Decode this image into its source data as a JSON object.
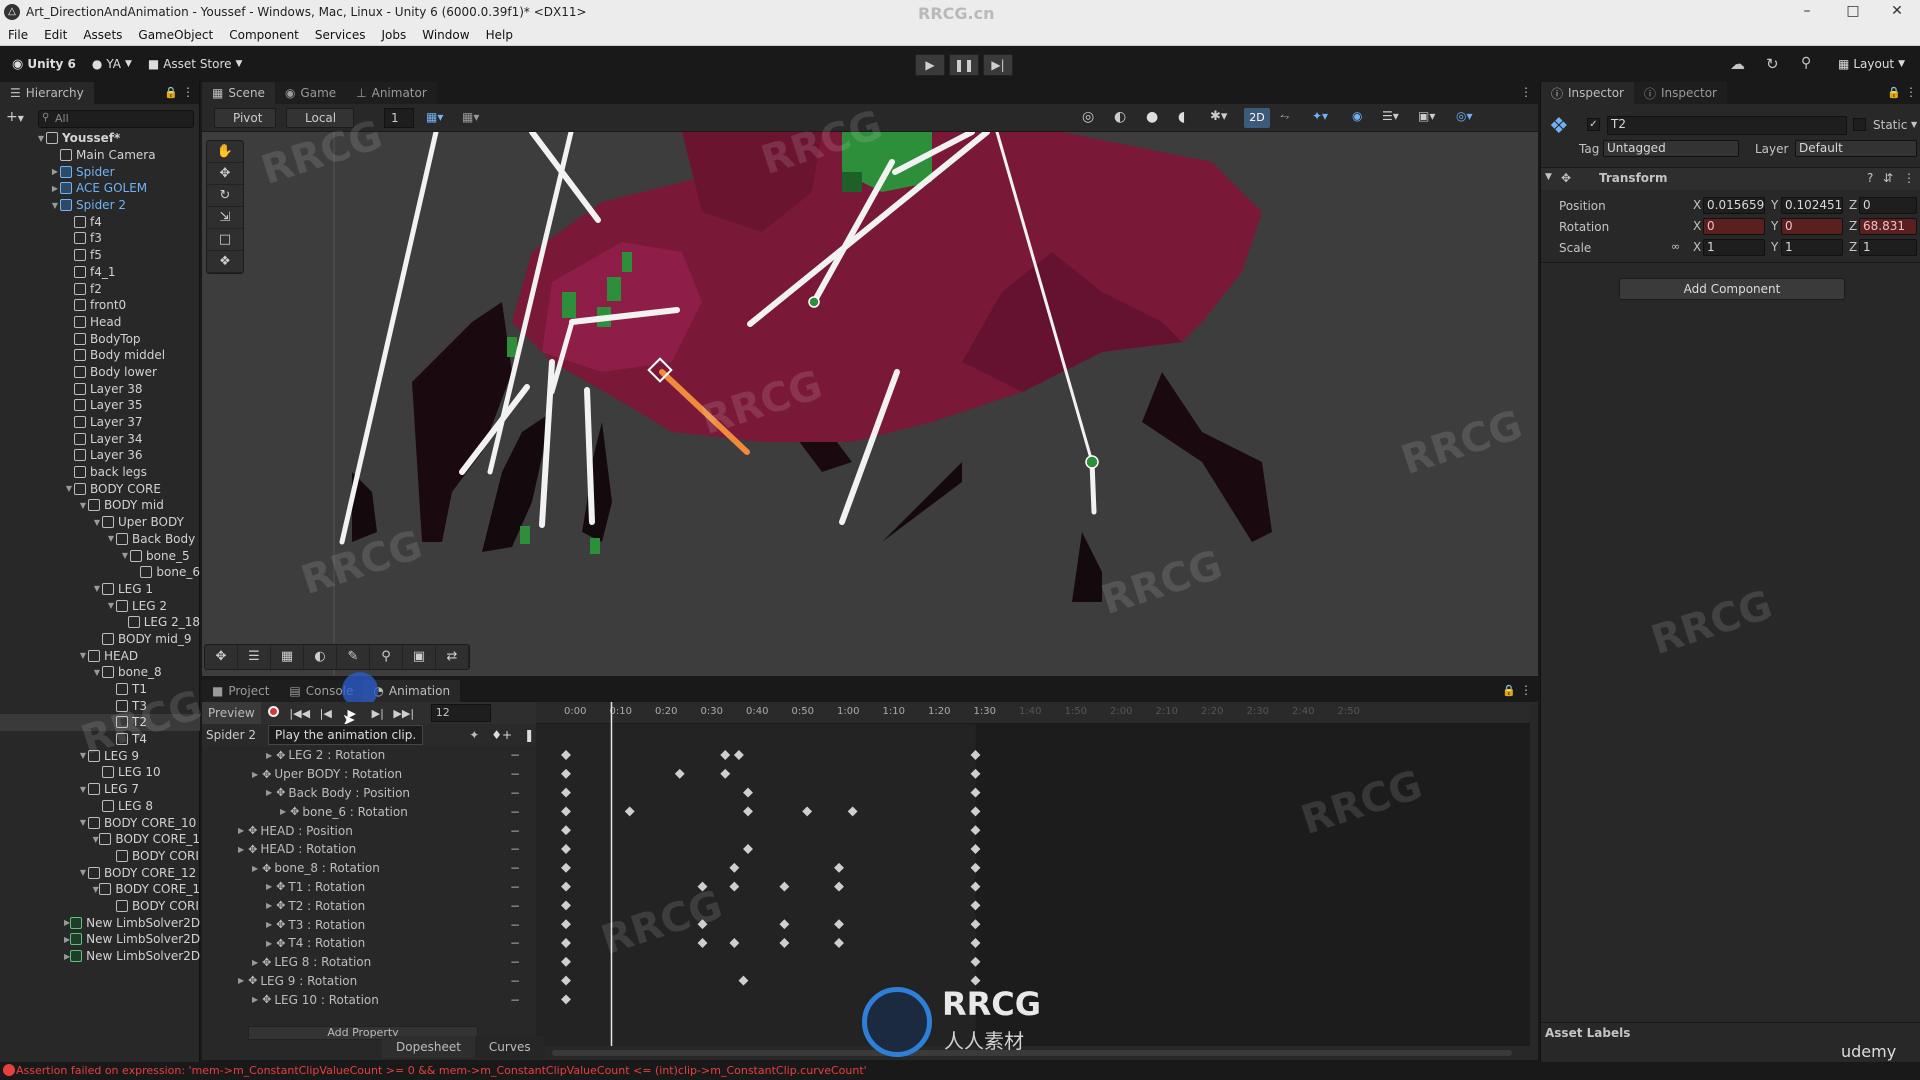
{
  "window": {
    "title": "Art_DirectionAndAnimation - Youssef - Windows, Mac, Linux - Unity 6 (6000.0.39f1)* <DX11>",
    "watermark_top": "RRCG.cn",
    "controls": [
      "–",
      "□",
      "✕"
    ]
  },
  "menu": [
    "File",
    "Edit",
    "Assets",
    "GameObject",
    "Component",
    "Services",
    "Jobs",
    "Window",
    "Help"
  ],
  "toolbar": {
    "unity_label": "Unity 6",
    "account_label": "YA",
    "asset_store_label": "Asset Store",
    "layout_label": "Layout"
  },
  "hierarchy": {
    "tab_label": "Hierarchy",
    "search_placeholder": "All",
    "items": [
      {
        "label": "Youssef*",
        "depth": 0,
        "arrow": "down",
        "type": "root"
      },
      {
        "label": "Main Camera",
        "depth": 1,
        "arrow": "",
        "type": "obj"
      },
      {
        "label": "Spider",
        "depth": 1,
        "arrow": "right",
        "type": "blue"
      },
      {
        "label": "ACE GOLEM",
        "depth": 1,
        "arrow": "right",
        "type": "blue"
      },
      {
        "label": "Spider 2",
        "depth": 1,
        "arrow": "down",
        "type": "blue"
      },
      {
        "label": "f4",
        "depth": 2,
        "arrow": "",
        "type": "obj"
      },
      {
        "label": "f3",
        "depth": 2,
        "arrow": "",
        "type": "obj"
      },
      {
        "label": "f5",
        "depth": 2,
        "arrow": "",
        "type": "obj"
      },
      {
        "label": "f4_1",
        "depth": 2,
        "arrow": "",
        "type": "obj"
      },
      {
        "label": "f2",
        "depth": 2,
        "arrow": "",
        "type": "obj"
      },
      {
        "label": "front0",
        "depth": 2,
        "arrow": "",
        "type": "obj"
      },
      {
        "label": "Head",
        "depth": 2,
        "arrow": "",
        "type": "obj"
      },
      {
        "label": "BodyTop",
        "depth": 2,
        "arrow": "",
        "type": "obj"
      },
      {
        "label": "Body middel",
        "depth": 2,
        "arrow": "",
        "type": "obj"
      },
      {
        "label": "Body lower",
        "depth": 2,
        "arrow": "",
        "type": "obj"
      },
      {
        "label": "Layer 38",
        "depth": 2,
        "arrow": "",
        "type": "obj"
      },
      {
        "label": "Layer 35",
        "depth": 2,
        "arrow": "",
        "type": "obj"
      },
      {
        "label": "Layer 37",
        "depth": 2,
        "arrow": "",
        "type": "obj"
      },
      {
        "label": "Layer 34",
        "depth": 2,
        "arrow": "",
        "type": "obj"
      },
      {
        "label": "Layer 36",
        "depth": 2,
        "arrow": "",
        "type": "obj"
      },
      {
        "label": "back legs",
        "depth": 2,
        "arrow": "",
        "type": "obj"
      },
      {
        "label": "BODY CORE",
        "depth": 2,
        "arrow": "down",
        "type": "obj"
      },
      {
        "label": "BODY mid",
        "depth": 3,
        "arrow": "down",
        "type": "obj"
      },
      {
        "label": "Uper BODY",
        "depth": 4,
        "arrow": "down",
        "type": "obj"
      },
      {
        "label": "Back Body",
        "depth": 5,
        "arrow": "down",
        "type": "obj"
      },
      {
        "label": "bone_5",
        "depth": 6,
        "arrow": "down",
        "type": "obj"
      },
      {
        "label": "bone_6",
        "depth": 7,
        "arrow": "",
        "type": "obj"
      },
      {
        "label": "LEG 1",
        "depth": 4,
        "arrow": "down",
        "type": "obj"
      },
      {
        "label": "LEG 2",
        "depth": 5,
        "arrow": "down",
        "type": "obj"
      },
      {
        "label": "LEG 2_18",
        "depth": 6,
        "arrow": "",
        "type": "obj"
      },
      {
        "label": "BODY mid_9",
        "depth": 4,
        "arrow": "",
        "type": "obj"
      },
      {
        "label": "HEAD",
        "depth": 3,
        "arrow": "down",
        "type": "obj"
      },
      {
        "label": "bone_8",
        "depth": 4,
        "arrow": "down",
        "type": "obj"
      },
      {
        "label": "T1",
        "depth": 5,
        "arrow": "",
        "type": "obj"
      },
      {
        "label": "T3",
        "depth": 5,
        "arrow": "",
        "type": "obj"
      },
      {
        "label": "T2",
        "depth": 5,
        "arrow": "",
        "type": "selected"
      },
      {
        "label": "T4",
        "depth": 5,
        "arrow": "",
        "type": "obj"
      },
      {
        "label": "LEG 9",
        "depth": 3,
        "arrow": "down",
        "type": "obj"
      },
      {
        "label": "LEG 10",
        "depth": 4,
        "arrow": "",
        "type": "obj"
      },
      {
        "label": "LEG 7",
        "depth": 3,
        "arrow": "down",
        "type": "obj"
      },
      {
        "label": "LEG 8",
        "depth": 4,
        "arrow": "",
        "type": "obj"
      },
      {
        "label": "BODY CORE_10",
        "depth": 3,
        "arrow": "down",
        "type": "obj"
      },
      {
        "label": "BODY CORE_1",
        "depth": 4,
        "arrow": "down",
        "type": "obj"
      },
      {
        "label": "BODY CORI",
        "depth": 5,
        "arrow": "",
        "type": "obj"
      },
      {
        "label": "BODY CORE_12",
        "depth": 3,
        "arrow": "down",
        "type": "obj"
      },
      {
        "label": "BODY CORE_1",
        "depth": 4,
        "arrow": "down",
        "type": "obj"
      },
      {
        "label": "BODY CORI",
        "depth": 5,
        "arrow": "",
        "type": "obj"
      },
      {
        "label": "New LimbSolver2D",
        "depth": 2,
        "arrow": "right",
        "type": "green"
      },
      {
        "label": "New LimbSolver2D",
        "depth": 2,
        "arrow": "right",
        "type": "green"
      },
      {
        "label": "New LimbSolver2D",
        "depth": 2,
        "arrow": "right",
        "type": "green"
      }
    ]
  },
  "scene": {
    "tabs": [
      {
        "label": "Scene",
        "icon": "grid-icon",
        "active": true
      },
      {
        "label": "Game",
        "icon": "gamepad-icon",
        "active": false
      },
      {
        "label": "Animator",
        "icon": "animator-icon",
        "active": false
      }
    ],
    "pivot_label": "Pivot",
    "space_label": "Local",
    "grid_value": "1",
    "mode_2d_label": "2D"
  },
  "animation": {
    "tabs": [
      {
        "label": "Project",
        "icon": "folder-icon",
        "active": false
      },
      {
        "label": "Console",
        "icon": "console-icon",
        "active": false
      },
      {
        "label": "Animation",
        "icon": "animation-icon",
        "active": true
      }
    ],
    "preview_label": "Preview",
    "frame_value": "12",
    "clip_name": "Spider 2",
    "tooltip": "Play the animation clip.",
    "ruler_labels": [
      "0:00",
      "0:10",
      "0:20",
      "0:30",
      "0:40",
      "0:50",
      "1:00",
      "1:10",
      "1:20",
      "1:30",
      "1:40",
      "1:50",
      "2:00",
      "2:10",
      "2:20",
      "2:30",
      "2:40",
      "2:50"
    ],
    "playhead_time": "0:10",
    "clip_end_time": "1:30",
    "properties": [
      {
        "label": "LEG 2 : Rotation",
        "depth": 2,
        "keys": [
          "0:00",
          "0:35",
          "0:38",
          "1:30"
        ]
      },
      {
        "label": "Uper BODY : Rotation",
        "depth": 1,
        "keys": [
          "0:00",
          "0:25",
          "0:35",
          "1:30"
        ]
      },
      {
        "label": "Back Body : Position",
        "depth": 2,
        "keys": [
          "0:00",
          "0:40",
          "1:30"
        ]
      },
      {
        "label": "bone_6 : Rotation",
        "depth": 3,
        "keys": [
          "0:00",
          "0:14",
          "0:40",
          "0:53",
          "1:03",
          "1:30"
        ]
      },
      {
        "label": "HEAD : Position",
        "depth": 0,
        "keys": [
          "0:00",
          "1:30"
        ]
      },
      {
        "label": "HEAD : Rotation",
        "depth": 0,
        "keys": [
          "0:00",
          "0:40",
          "1:30"
        ]
      },
      {
        "label": "bone_8 : Rotation",
        "depth": 1,
        "keys": [
          "0:00",
          "0:37",
          "1:00",
          "1:30"
        ]
      },
      {
        "label": "T1 : Rotation",
        "depth": 2,
        "keys": [
          "0:00",
          "0:30",
          "0:37",
          "0:48",
          "1:00",
          "1:30"
        ]
      },
      {
        "label": "T2 : Rotation",
        "depth": 2,
        "keys": [
          "0:00",
          "1:30"
        ]
      },
      {
        "label": "T3 : Rotation",
        "depth": 2,
        "keys": [
          "0:00",
          "0:30",
          "0:48",
          "1:00",
          "1:30"
        ]
      },
      {
        "label": "T4 : Rotation",
        "depth": 2,
        "keys": [
          "0:00",
          "0:30",
          "0:37",
          "0:48",
          "1:00",
          "1:30"
        ]
      },
      {
        "label": "LEG 8 : Rotation",
        "depth": 1,
        "keys": [
          "0:00",
          "1:30"
        ]
      },
      {
        "label": "LEG 9 : Rotation",
        "depth": 0,
        "keys": [
          "0:00",
          "0:39",
          "1:30"
        ]
      },
      {
        "label": "LEG 10 : Rotation",
        "depth": 1,
        "keys": [
          "0:00"
        ]
      }
    ],
    "add_property_label": "Add Property",
    "bottom_tabs": [
      "Dopesheet",
      "Curves"
    ]
  },
  "inspector": {
    "tabs": [
      {
        "label": "Inspector",
        "active": true
      },
      {
        "label": "Inspector",
        "active": false
      }
    ],
    "object_name": "T2",
    "static_label": "Static",
    "tag_label": "Tag",
    "tag_value": "Untagged",
    "layer_label": "Layer",
    "layer_value": "Default",
    "transform_label": "Transform",
    "position": {
      "label": "Position",
      "x": "0.015659",
      "y": "0.102451",
      "z": "0"
    },
    "rotation": {
      "label": "Rotation",
      "x": "0",
      "y": "0",
      "z": "68.831"
    },
    "scale": {
      "label": "Scale",
      "x": "1",
      "y": "1",
      "z": "1"
    },
    "add_component_label": "Add Component",
    "asset_labels": "Asset Labels",
    "axis_x": "X",
    "axis_y": "Y",
    "axis_z": "Z"
  },
  "status": {
    "error_text": "Assertion failed on expression: 'mem->m_ConstantClipValueCount >= 0 && mem->m_ConstantClipValueCount <= (int)clip->m_ConstantClip.curveCount'"
  },
  "overlay": {
    "logo_text": "RRCG",
    "logo_sub": "人人素材",
    "udemy": "udemy"
  },
  "colors": {
    "accent_blue": "#6fb2f5",
    "record_red": "#d03a3a",
    "spider_body": "#7a1838",
    "selected_bone": "#f08a3c",
    "error_red": "#e84040"
  }
}
